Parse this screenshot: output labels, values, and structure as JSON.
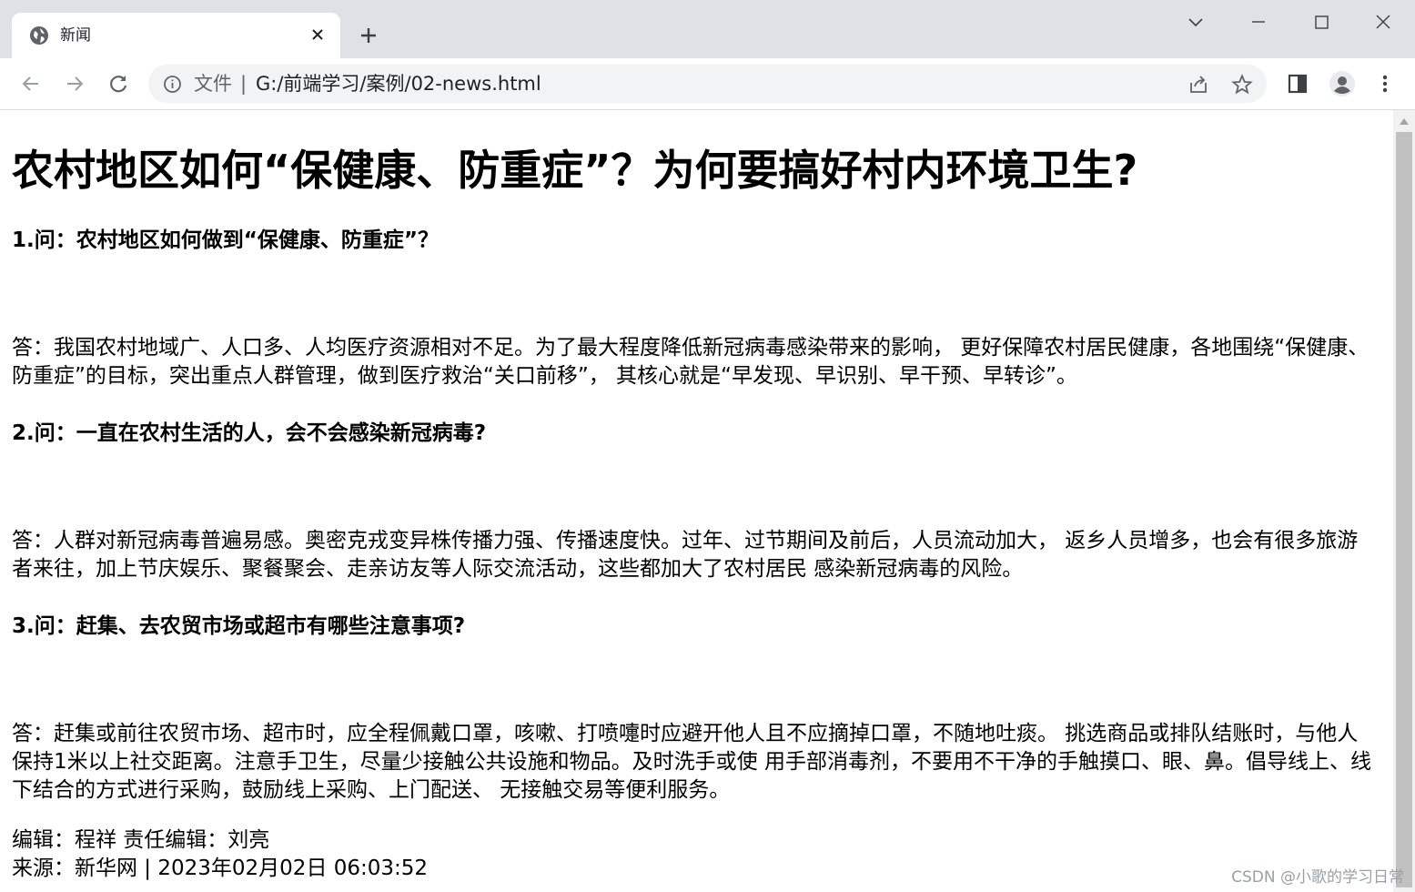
{
  "browser": {
    "tab_title": "新闻",
    "url_scheme_label": "文件",
    "url_separator": "|",
    "url": "G:/前端学习/案例/02-news.html",
    "icons": [
      "globe-icon",
      "close-icon",
      "plus-icon",
      "chevron-down-icon",
      "minimize-icon",
      "maximize-icon",
      "window-close-icon",
      "back-icon",
      "forward-icon",
      "reload-icon",
      "info-icon",
      "share-icon",
      "star-icon",
      "side-panel-icon",
      "profile-icon",
      "menu-icon"
    ]
  },
  "article": {
    "title": "农村地区如何“保健康、防重症”？为何要搞好村内环境卫生?",
    "sections": [
      {
        "question": "1.问：农村地区如何做到“保健康、防重症”？",
        "answer": "答：我国农村地域广、人口多、人均医疗资源相对不足。为了最大程度降低新冠病毒感染带来的影响， 更好保障农村居民健康，各地围绕“保健康、防重症”的目标，突出重点人群管理，做到医疗救治“关口前移”， 其核心就是“早发现、早识别、早干预、早转诊”。"
      },
      {
        "question": "2.问：一直在农村生活的人，会不会感染新冠病毒?",
        "answer": "答：人群对新冠病毒普遍易感。奥密克戎变异株传播力强、传播速度快。过年、过节期间及前后，人员流动加大， 返乡人员增多，也会有很多旅游者来往，加上节庆娱乐、聚餐聚会、走亲访友等人际交流活动，这些都加大了农村居民 感染新冠病毒的风险。"
      },
      {
        "question": "3.问：赶集、去农贸市场或超市有哪些注意事项?",
        "answer": "答：赶集或前往农贸市场、超市时，应全程佩戴口罩，咳嗽、打喷嚏时应避开他人且不应摘掉口罩，不随地吐痰。 挑选商品或排队结账时，与他人保持1米以上社交距离。注意手卫生，尽量少接触公共设施和物品。及时洗手或使 用手部消毒剂，不要用不干净的手触摸口、眼、鼻。倡导线上、线下结合的方式进行采购，鼓励线上采购、上门配送、 无接触交易等便利服务。"
      }
    ],
    "editor_line": "编辑：程祥 责任编辑：刘亮",
    "source_line": "来源：新华网 | 2023年02月02日 06:03:52"
  },
  "watermark": "CSDN @小歌的学习日常",
  "colors": {
    "tabbar_bg": "#dee1e6",
    "omnibox_bg": "#f1f3f4",
    "icon": "#5f6368"
  }
}
